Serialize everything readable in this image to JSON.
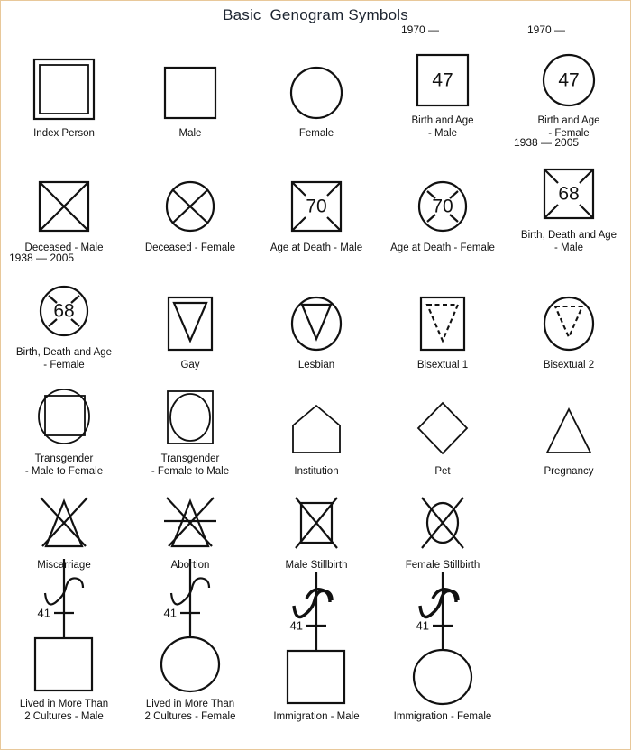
{
  "page": {
    "title": "Basic  Genogram Symbols",
    "border_color": "#e8c89a",
    "ink_color": "#111111"
  },
  "rows": [
    {
      "row_index": 1,
      "cells": [
        {
          "id": "index-person",
          "shape": "double-square",
          "caption": "Index Person"
        },
        {
          "id": "male",
          "shape": "square",
          "caption": "Male"
        },
        {
          "id": "female",
          "shape": "circle",
          "caption": "Female"
        },
        {
          "id": "birth-and-age-male",
          "shape": "square-number",
          "number": "47",
          "date_label": "1970 —",
          "caption": "Birth and Age\n- Male"
        },
        {
          "id": "birth-and-age-female",
          "shape": "circle-number",
          "number": "47",
          "date_label": "1970 —",
          "caption": "Birth and Age\n- Female"
        }
      ]
    },
    {
      "row_index": 2,
      "cells": [
        {
          "id": "deceased-male",
          "shape": "square-x",
          "caption": "Deceased - Male"
        },
        {
          "id": "deceased-female",
          "shape": "circle-x",
          "caption": "Deceased - Female"
        },
        {
          "id": "age-at-death-male",
          "shape": "square-corner-x-number",
          "number": "70",
          "caption": "Age at Death - Male"
        },
        {
          "id": "age-at-death-female",
          "shape": "circle-corner-x-number",
          "number": "70",
          "caption": "Age at Death - Female"
        },
        {
          "id": "birth-death-age-male",
          "shape": "square-corner-x-number",
          "number": "68",
          "date_label": "1938 — 2005",
          "caption": "Birth, Death and Age\n- Male"
        }
      ]
    },
    {
      "row_index": 3,
      "cells": [
        {
          "id": "birth-death-age-female",
          "shape": "circle-corner-x-number",
          "number": "68",
          "date_label": "1938 — 2005",
          "caption": "Birth, Death and Age\n- Female"
        },
        {
          "id": "gay",
          "shape": "square-triangle",
          "caption": "Gay"
        },
        {
          "id": "lesbian",
          "shape": "circle-triangle",
          "caption": "Lesbian"
        },
        {
          "id": "bisexual-1",
          "shape": "square-triangle-dashed",
          "caption": "Bisextual 1"
        },
        {
          "id": "bisexual-2",
          "shape": "circle-triangle-dashed",
          "caption": "Bisextual 2"
        }
      ]
    },
    {
      "row_index": 4,
      "cells": [
        {
          "id": "transgender-male-to-female",
          "shape": "circle-with-square",
          "caption": "Transgender\n- Male to Female"
        },
        {
          "id": "transgender-female-to-male",
          "shape": "square-with-circle",
          "caption": "Transgender\n- Female to Male"
        },
        {
          "id": "institution",
          "shape": "pentagon-house",
          "caption": "Institution"
        },
        {
          "id": "pet",
          "shape": "diamond",
          "caption": "Pet"
        },
        {
          "id": "pregnancy",
          "shape": "triangle",
          "caption": "Pregnancy"
        }
      ]
    },
    {
      "row_index": 5,
      "cells": [
        {
          "id": "miscarriage",
          "shape": "triangle-crossed",
          "caption": "Miscarriage"
        },
        {
          "id": "abortion",
          "shape": "triangle-crossed-bar",
          "caption": "Abortion"
        },
        {
          "id": "male-stillbirth",
          "shape": "square-big-x",
          "caption": "Male Stillbirth"
        },
        {
          "id": "female-stillbirth",
          "shape": "circle-big-x",
          "caption": "Female Stillbirth"
        },
        {
          "id": "blank-r5",
          "shape": "blank",
          "caption": ""
        }
      ]
    },
    {
      "row_index": 6,
      "cells": [
        {
          "id": "lived-more-cultures-male",
          "shape": "squiggle-square",
          "age": "41",
          "caption": "Lived in More Than\n2 Cultures - Male"
        },
        {
          "id": "lived-more-cultures-female",
          "shape": "squiggle-circle",
          "age": "41",
          "caption": "Lived in More Than\n2 Cultures - Female"
        },
        {
          "id": "immigration-male",
          "shape": "squiggle-bold-square",
          "age": "41",
          "caption": "Immigration - Male"
        },
        {
          "id": "immigration-female",
          "shape": "squiggle-bold-circle",
          "age": "41",
          "caption": "Immigration - Female"
        },
        {
          "id": "blank-r6",
          "shape": "blank",
          "caption": ""
        }
      ]
    }
  ]
}
